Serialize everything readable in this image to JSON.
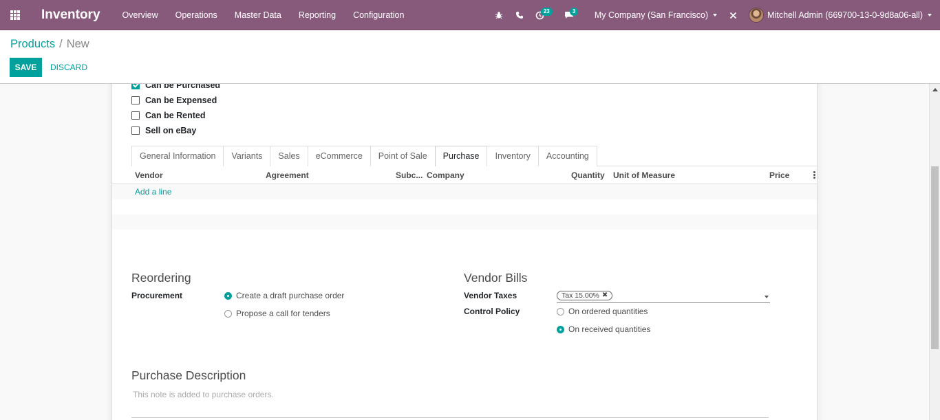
{
  "app": {
    "title": "Inventory"
  },
  "navbar": {
    "menu": [
      {
        "label": "Overview"
      },
      {
        "label": "Operations"
      },
      {
        "label": "Master Data"
      },
      {
        "label": "Reporting"
      },
      {
        "label": "Configuration"
      }
    ],
    "activity_count": "23",
    "message_count": "3",
    "company": "My Company (San Francisco)",
    "user": "Mitchell Admin (669700-13-0-9d8a06-all)",
    "accent_color": "#875a7b"
  },
  "breadcrumb": {
    "parent": "Products",
    "separator": "/",
    "current": "New"
  },
  "actions": {
    "save": "SAVE",
    "discard": "DISCARD",
    "primary_color": "#00a09d"
  },
  "options": [
    {
      "label": "Can be Purchased",
      "checked": true
    },
    {
      "label": "Can be Expensed",
      "checked": false
    },
    {
      "label": "Can be Rented",
      "checked": false
    },
    {
      "label": "Sell on eBay",
      "checked": false
    }
  ],
  "tabs": [
    {
      "label": "General Information",
      "active": false
    },
    {
      "label": "Variants",
      "active": false
    },
    {
      "label": "Sales",
      "active": false
    },
    {
      "label": "eCommerce",
      "active": false
    },
    {
      "label": "Point of Sale",
      "active": false
    },
    {
      "label": "Purchase",
      "active": true
    },
    {
      "label": "Inventory",
      "active": false
    },
    {
      "label": "Accounting",
      "active": false
    }
  ],
  "vendor_list": {
    "columns": [
      "Vendor",
      "Agreement",
      "Subc...",
      "Company",
      "Quantity",
      "Unit of Measure",
      "Price"
    ],
    "add_line": "Add a line"
  },
  "reordering": {
    "title": "Reordering",
    "procurement_label": "Procurement",
    "options": [
      {
        "label": "Create a draft purchase order",
        "selected": true
      },
      {
        "label": "Propose a call for tenders",
        "selected": false
      }
    ]
  },
  "vendor_bills": {
    "title": "Vendor Bills",
    "taxes_label": "Vendor Taxes",
    "tax_tag": "Tax 15.00%",
    "control_policy_label": "Control Policy",
    "options": [
      {
        "label": "On ordered quantities",
        "selected": false
      },
      {
        "label": "On received quantities",
        "selected": true
      }
    ]
  },
  "purchase_description": {
    "title": "Purchase Description",
    "placeholder": "This note is added to purchase orders."
  }
}
